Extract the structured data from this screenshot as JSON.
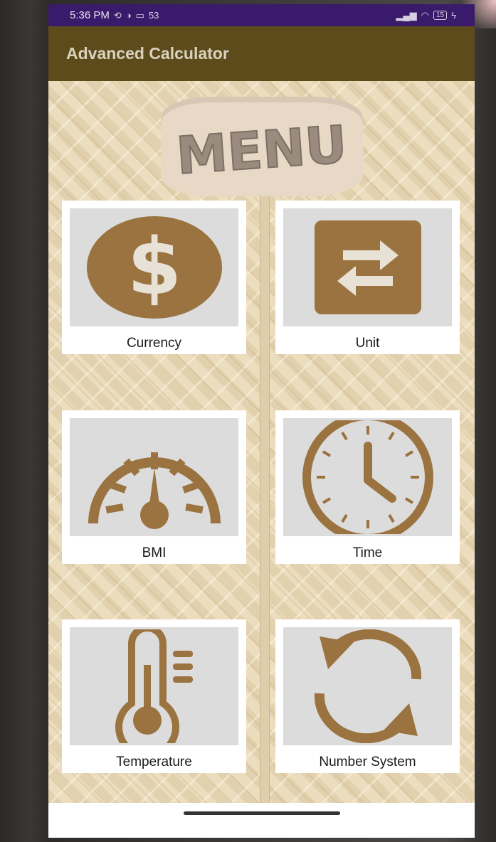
{
  "status_bar": {
    "time": "5:36 PM",
    "left_icons": [
      "nosync-icon",
      "vpn-icon",
      "sim-icon",
      "data-icon"
    ],
    "left_icon_glyph_text": "53",
    "right_icons": [
      "signal-icon",
      "wifi-icon",
      "battery-icon",
      "charging-icon"
    ],
    "battery_label": "15"
  },
  "app_bar": {
    "title": "Advanced Calculator"
  },
  "menu_sign": {
    "text": "MENU"
  },
  "menu_items": [
    {
      "label": "Currency",
      "icon": "dollar-coin-icon"
    },
    {
      "label": "Unit",
      "icon": "swap-arrows-icon"
    },
    {
      "label": "BMI",
      "icon": "gauge-icon"
    },
    {
      "label": "Time",
      "icon": "clock-icon"
    },
    {
      "label": "Temperature",
      "icon": "thermometer-icon"
    },
    {
      "label": "Number System",
      "icon": "refresh-arrows-icon"
    }
  ],
  "colors": {
    "status_bar_bg": "#3a1a6a",
    "app_bar_bg": "#5e4b1c",
    "icon_brown": "#9a7340",
    "card_inner": "#dcdcdc"
  }
}
